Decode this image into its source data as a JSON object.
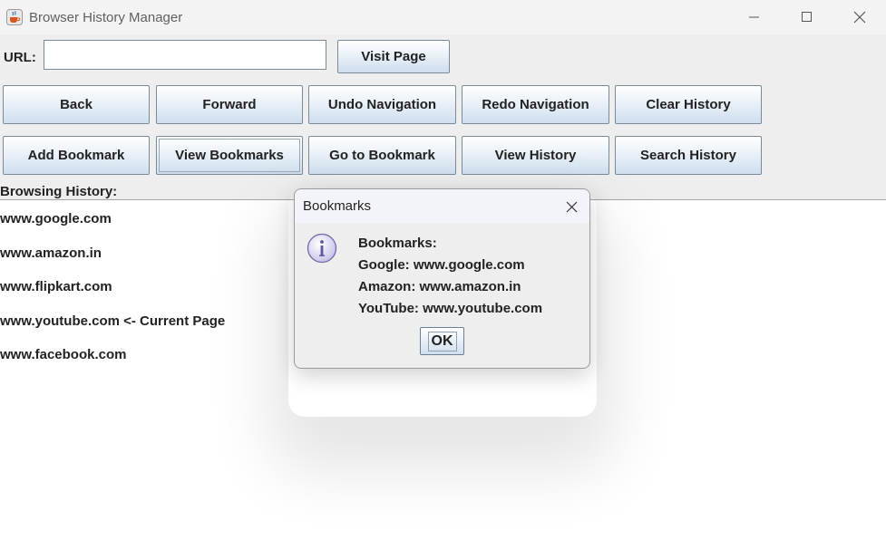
{
  "window": {
    "title": "Browser History Manager",
    "app_icon": "java-coffee-cup-icon",
    "controls": [
      "minimize-icon",
      "maximize-icon",
      "close-icon"
    ]
  },
  "url_bar": {
    "label": "URL:",
    "value": "",
    "visit_label": "Visit Page"
  },
  "buttons_row1": [
    "Back",
    "Forward",
    "Undo Navigation",
    "Redo Navigation",
    "Clear History"
  ],
  "buttons_row2": [
    "Add Bookmark",
    "View Bookmarks",
    "Go to Bookmark",
    "View History",
    "Search History"
  ],
  "history": {
    "header": "Browsing History:",
    "items": [
      "www.google.com",
      "www.amazon.in",
      "www.flipkart.com",
      "www.youtube.com <- Current Page",
      "www.facebook.com"
    ]
  },
  "dialog": {
    "title": "Bookmarks",
    "icon": "info-icon",
    "lines": [
      "Bookmarks:",
      "Google: www.google.com",
      "Amazon: www.amazon.in",
      "YouTube: www.youtube.com"
    ],
    "ok_label": "OK"
  }
}
